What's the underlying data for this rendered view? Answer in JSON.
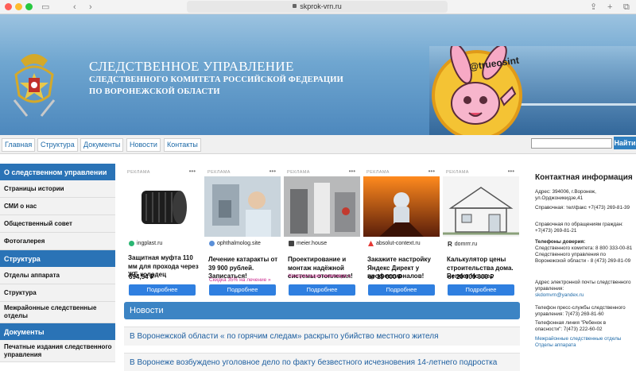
{
  "browser": {
    "url": "skprok-vrn.ru"
  },
  "header": {
    "title_line1": "СЛЕДСТВЕННОЕ УПРАВЛЕНИЕ",
    "title_line2": "СЛЕДСТВЕННОГО КОМИТЕТА РОССИЙСКОЙ ФЕДЕРАЦИИ",
    "title_line3": "ПО ВОРОНЕЖСКОЙ ОБЛАСТИ",
    "sticker": "@trueosint"
  },
  "nav": {
    "items": [
      "Главная",
      "Структура",
      "Документы",
      "Новости",
      "Контакты"
    ],
    "search_value": "",
    "find_label": "Найти"
  },
  "sidebar": [
    {
      "label": "О следственном управлении",
      "section": true
    },
    {
      "label": "Страницы истории",
      "section": false
    },
    {
      "label": "СМИ о нас",
      "section": false
    },
    {
      "label": "Общественный совет",
      "section": false
    },
    {
      "label": "Фотогалерея",
      "section": false
    },
    {
      "label": "Структура",
      "section": true
    },
    {
      "label": "Отделы аппарата",
      "section": false
    },
    {
      "label": "Структура",
      "section": false
    },
    {
      "label": "Межрайонные следственные отделы",
      "section": false
    },
    {
      "label": "Документы",
      "section": true
    },
    {
      "label": "Печатные издания следственного управления",
      "section": false
    }
  ],
  "ads": {
    "label": "РЕКЛАМА",
    "button": "Подробнее",
    "items": [
      {
        "domain": "ingplast.ru",
        "title": "Защитная муфта 110 мм для прохода через ЖБ колодец",
        "price": "694,54 ₽",
        "sub": "",
        "icon": "ingplast-icon"
      },
      {
        "domain": "ophthalmolog.site",
        "title": "Лечение катаракты от 39 900 рублей. Записаться!",
        "price": "",
        "sub": "Скидка 35% на лечение »",
        "icon": "ophthalmolog-icon"
      },
      {
        "domain": "meier.house",
        "title": "Проектирование и монтаж надёжной системы отопления!",
        "price": "",
        "sub": "Консультация инженера »",
        "icon": "meier-icon"
      },
      {
        "domain": "absolut-context.ru",
        "title": "Закажите настройку Яндекс Директ у профессионалов!",
        "price": "от 15 000 ₽",
        "sub": "",
        "icon": "absolut-icon"
      },
      {
        "domain": "domrrr.ru",
        "title": "Калькулятор цены строительства дома. Render House",
        "price": "от 20 000 000 ₽",
        "sub": "",
        "icon": "domrrr-icon"
      }
    ]
  },
  "news": {
    "heading": "Новости",
    "items": [
      "В Воронежской области « по горячим следам» раскрыто убийство местного жителя",
      "В Воронеже возбуждено уголовное дело по факту безвестного исчезновения 14-летнего подростка"
    ]
  },
  "contacts": {
    "heading": "Контактная информация",
    "address": "Адрес: 394006, г.Воронеж, ул.Орджоникидзе,41",
    "help": "Справочная: тел/факс +7(473) 269-81-39",
    "citizens": "Справочная по обращениям граждан: +7(473) 269-81-21",
    "trust_label": "Телефоны доверия:",
    "trust": "Следственного комитета: 8 800 333-00-81 Следственного управления по Воронежской области - 8 (473) 269-81-09",
    "email_label": "Адрес электронной почты следственного управления:",
    "email": "skdomvrn@yandex.ru",
    "press": "Телефон пресс-службы следственного управления: 7(473) 269-81-60",
    "child": "Телефонная линия \"Ребенок в опасности\": 7(473) 222-60-02",
    "links": "Межрайонные следственные отделы Отделы аппарата"
  }
}
